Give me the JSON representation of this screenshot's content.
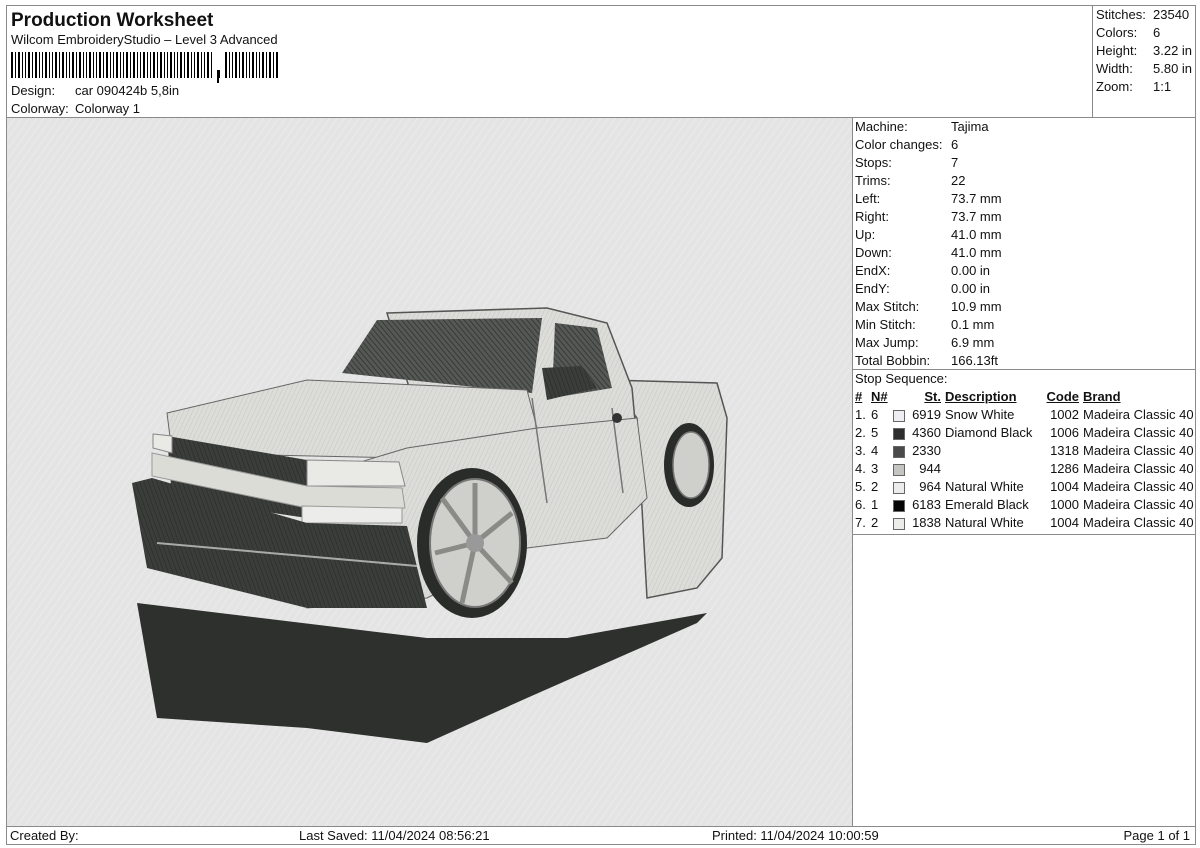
{
  "header": {
    "title": "Production Worksheet",
    "subtitle": "Wilcom EmbroideryStudio – Level 3 Advanced",
    "design_label": "Design:",
    "design_value": "car 090424b 5,8in",
    "colorway_label": "Colorway:",
    "colorway_value": "Colorway 1"
  },
  "summary": [
    {
      "label": "Stitches:",
      "value": "23540"
    },
    {
      "label": "Colors:",
      "value": "6"
    },
    {
      "label": "Height:",
      "value": "3.22 in"
    },
    {
      "label": "Width:",
      "value": "5.80 in"
    },
    {
      "label": "Zoom:",
      "value": "1:1"
    }
  ],
  "machine_info": [
    {
      "label": "Machine:",
      "value": "Tajima"
    },
    {
      "label": "Color changes:",
      "value": "6"
    },
    {
      "label": "Stops:",
      "value": "7"
    },
    {
      "label": "Trims:",
      "value": "22"
    },
    {
      "label": "Left:",
      "value": "73.7 mm"
    },
    {
      "label": "Right:",
      "value": "73.7 mm"
    },
    {
      "label": "Up:",
      "value": "41.0 mm"
    },
    {
      "label": "Down:",
      "value": "41.0 mm"
    },
    {
      "label": "EndX:",
      "value": "0.00 in"
    },
    {
      "label": "EndY:",
      "value": "0.00 in"
    },
    {
      "label": "Max Stitch:",
      "value": "10.9 mm"
    },
    {
      "label": "Min Stitch:",
      "value": "0.1 mm"
    },
    {
      "label": "Max Jump:",
      "value": "6.9 mm"
    },
    {
      "label": "Total Bobbin:",
      "value": "166.13ft"
    }
  ],
  "stop_sequence": {
    "title": "Stop Sequence:",
    "headers": {
      "num": "#",
      "n": "N#",
      "st": "St.",
      "desc": "Description",
      "code": "Code",
      "brand": "Brand"
    },
    "rows": [
      {
        "num": "1.",
        "n": "6",
        "color": "#eeeef2",
        "st": "6919",
        "desc": "Snow White",
        "code": "1002",
        "brand": "Madeira Classic 40"
      },
      {
        "num": "2.",
        "n": "5",
        "color": "#2e2e2e",
        "st": "4360",
        "desc": "Diamond Black",
        "code": "1006",
        "brand": "Madeira Classic 40"
      },
      {
        "num": "3.",
        "n": "4",
        "color": "#4a4a4a",
        "st": "2330",
        "desc": "",
        "code": "1318",
        "brand": "Madeira Classic 40"
      },
      {
        "num": "4.",
        "n": "3",
        "color": "#c4c4c0",
        "st": "944",
        "desc": "",
        "code": "1286",
        "brand": "Madeira Classic 40"
      },
      {
        "num": "5.",
        "n": "2",
        "color": "#ececea",
        "st": "964",
        "desc": "Natural White",
        "code": "1004",
        "brand": "Madeira Classic 40"
      },
      {
        "num": "6.",
        "n": "1",
        "color": "#050505",
        "st": "6183",
        "desc": "Emerald Black",
        "code": "1000",
        "brand": "Madeira Classic 40"
      },
      {
        "num": "7.",
        "n": "2",
        "color": "#ececea",
        "st": "1838",
        "desc": "Natural White",
        "code": "1004",
        "brand": "Madeira Classic 40"
      }
    ]
  },
  "footer": {
    "created_by": "Created By:",
    "last_saved": "Last Saved: 11/04/2024 08:56:21",
    "printed": "Printed: 11/04/2024 10:00:59",
    "page": "Page 1 of 1"
  }
}
